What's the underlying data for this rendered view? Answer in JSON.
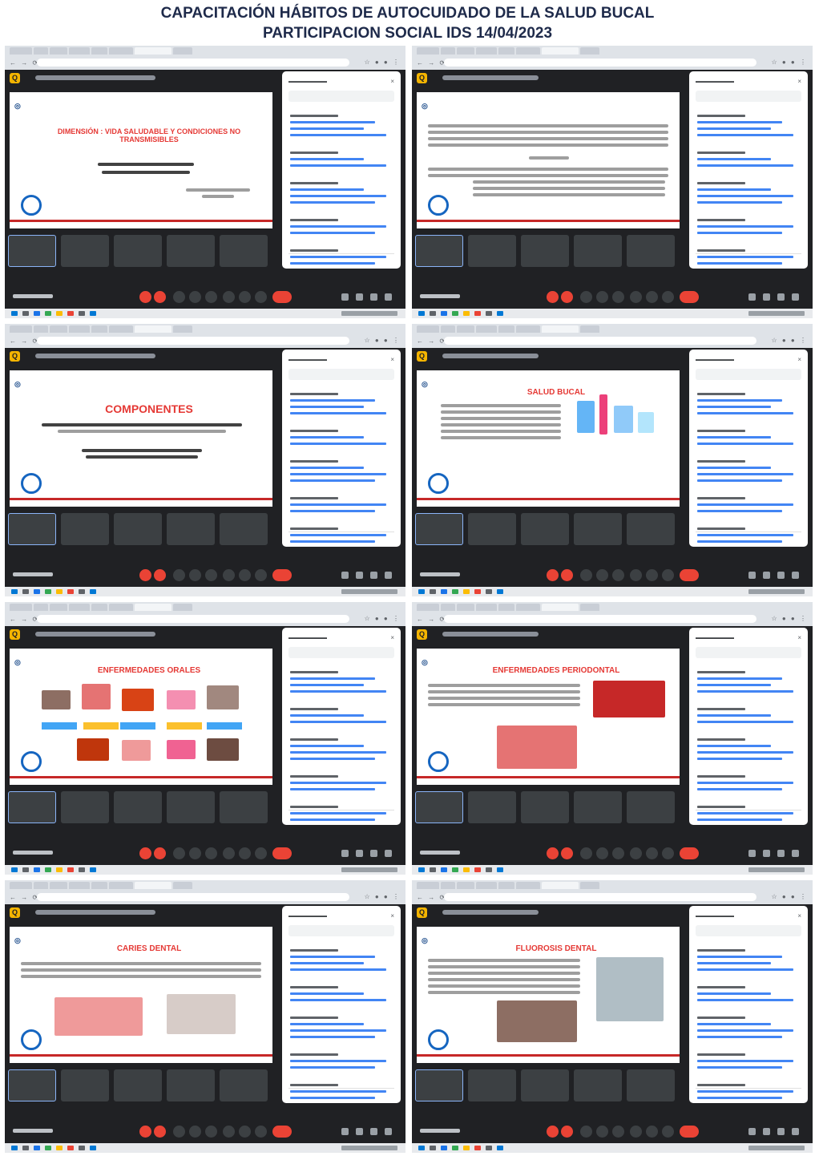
{
  "header": {
    "line1": "CAPACITACIÓN HÁBITOS DE AUTOCUIDADO DE LA SALUD BUCAL",
    "line2": "PARTICIPACION SOCIAL IDS 14/04/2023"
  },
  "colors": {
    "background": "#ffffff",
    "meet_dark": "#202124",
    "slide_title_red": "#e53935",
    "end_call_red": "#ea4335",
    "browser_chrome": "#dfe3e8",
    "accent_blue": "#42a5f5"
  },
  "icons": {
    "app_logo": "meet-logo-icon",
    "chat_close": "close-icon",
    "end_call": "end-call-icon",
    "mic": "mic-icon",
    "camera": "camera-icon"
  },
  "screenshots": [
    {
      "slide_title": "DIMENSIÓN : VIDA SALUDABLE Y CONDICIONES NO TRANSMISIBLES",
      "app_logo": "Q"
    },
    {
      "slide_title": "",
      "app_logo": "Q"
    },
    {
      "slide_title": "COMPONENTES",
      "app_logo": "Q"
    },
    {
      "slide_title": "SALUD BUCAL",
      "app_logo": "Q"
    },
    {
      "slide_title": "ENFERMEDADES ORALES",
      "app_logo": "Q"
    },
    {
      "slide_title": "ENFERMEDADES PERIODONTAL",
      "app_logo": "Q"
    },
    {
      "slide_title": "CARIES DENTAL",
      "app_logo": "Q"
    },
    {
      "slide_title": "FLUOROSIS DENTAL",
      "app_logo": "Q"
    }
  ]
}
